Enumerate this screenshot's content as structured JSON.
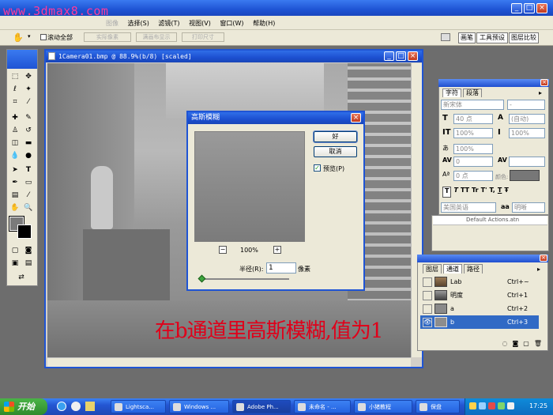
{
  "watermark": "www.3dmax8.com",
  "menubar": {
    "items": [
      "选择(S)",
      "滤镜(T)",
      "视图(V)",
      "窗口(W)",
      "帮助(H)"
    ],
    "faded": "图像"
  },
  "options_bar": {
    "scroll_all": "滚动全部",
    "actual_pixels": "实际像素",
    "fit_screen": "满画布显示",
    "print_size": "打印尺寸",
    "tabs": [
      "画笔",
      "工具预设",
      "图层比较"
    ]
  },
  "document": {
    "title": "1Camera01.bmp @ 88.9%(b/8) [scaled]"
  },
  "dialog": {
    "title": "高斯模糊",
    "ok": "好",
    "cancel": "取消",
    "preview_label": "预览(P)",
    "preview_checked": true,
    "zoom": "100%",
    "zoom_out": "−",
    "zoom_in": "+",
    "radius_label": "半径(R):",
    "radius_value": "1",
    "unit": "像素",
    "slider_level": 0.02
  },
  "character_panel": {
    "tabs": [
      "字符",
      "段落"
    ],
    "font": "新宋体",
    "style": "-",
    "size": "40 点",
    "leading": "(自动)",
    "vscale": "100%",
    "hscale": "100%",
    "tracking": "100%",
    "kerning": "0",
    "baseline": "0 点",
    "color_label": "颜色:",
    "language": "美国英语",
    "aa_label": "aa",
    "aa_value": "明晰",
    "style_buttons": [
      "T",
      "T",
      "TT",
      "Tr",
      "T'",
      "T,",
      "T",
      "Ŧ"
    ]
  },
  "actions_peek": "Default Actions.atn",
  "channels_panel": {
    "tabs": [
      "图层",
      "通道",
      "路径"
    ],
    "rows": [
      {
        "name": "Lab",
        "shortcut": "Ctrl+~",
        "selected": false
      },
      {
        "name": "明度",
        "shortcut": "Ctrl+1",
        "selected": false
      },
      {
        "name": "a",
        "shortcut": "Ctrl+2",
        "selected": false
      },
      {
        "name": "b",
        "shortcut": "Ctrl+3",
        "selected": true
      }
    ]
  },
  "annotation": "在b通道里高斯模糊,值为1",
  "taskbar": {
    "start": "开始",
    "items": [
      "Lightsca...",
      "Windows ...",
      "Adobe Ph...",
      "未命名 - ...",
      "小猪教程",
      "保盘"
    ],
    "clock": "17:25"
  },
  "colors": {
    "accent": "#1f4ecf",
    "annotation": "#e0001a",
    "watermark": "#ff3a9a",
    "taskbar": "#2456d2",
    "start": "#3c9a33"
  }
}
